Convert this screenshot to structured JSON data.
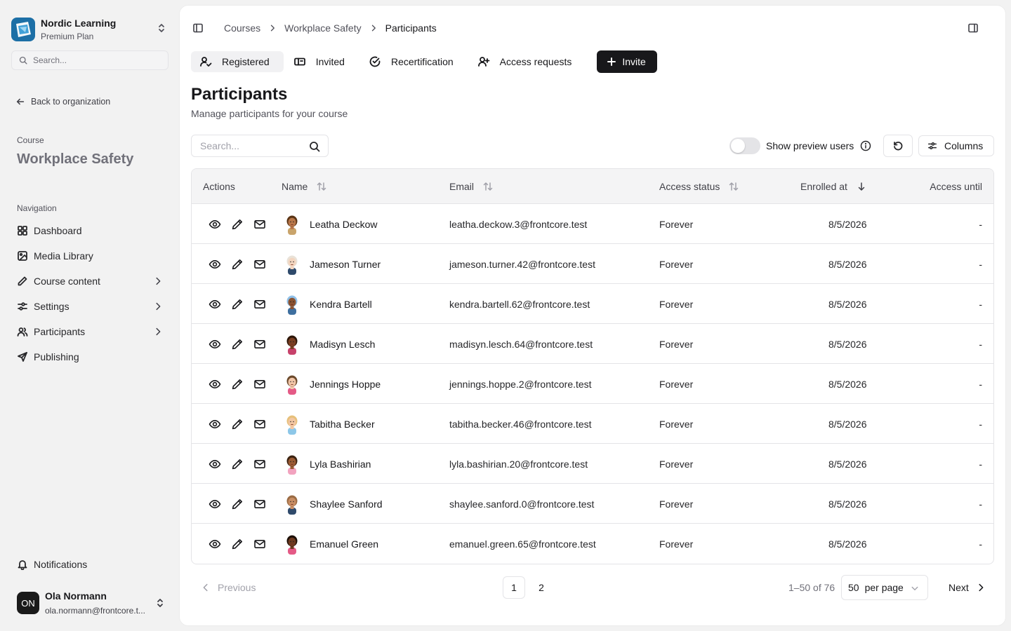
{
  "org": {
    "name": "Nordic Learning",
    "plan": "Premium Plan"
  },
  "sidebar": {
    "search_placeholder": "Search...",
    "back_label": "Back to organization",
    "course_label": "Course",
    "course_name": "Workplace Safety",
    "nav_label": "Navigation",
    "items": [
      {
        "label": "Dashboard",
        "icon": "dashboard-icon",
        "has_chevron": false
      },
      {
        "label": "Media Library",
        "icon": "image-icon",
        "has_chevron": false
      },
      {
        "label": "Course content",
        "icon": "pencil-icon",
        "has_chevron": true
      },
      {
        "label": "Settings",
        "icon": "settings-sliders-icon",
        "has_chevron": true
      },
      {
        "label": "Participants",
        "icon": "users-icon",
        "has_chevron": true
      },
      {
        "label": "Publishing",
        "icon": "send-icon",
        "has_chevron": false
      }
    ],
    "notifications_label": "Notifications",
    "user": {
      "initials": "ON",
      "name": "Ola Normann",
      "email": "ola.normann@frontcore.t..."
    }
  },
  "breadcrumb": [
    "Courses",
    "Workplace Safety",
    "Participants"
  ],
  "tabs": [
    {
      "label": "Registered",
      "icon": "user-check-icon",
      "active": true
    },
    {
      "label": "Invited",
      "icon": "ticket-icon",
      "active": false
    },
    {
      "label": "Recertification",
      "icon": "circle-check-icon",
      "active": false
    },
    {
      "label": "Access requests",
      "icon": "user-plus-icon",
      "active": false
    }
  ],
  "invite_label": "Invite",
  "page": {
    "title": "Participants",
    "subtitle": "Manage participants for your course"
  },
  "toolbar": {
    "search_placeholder": "Search...",
    "preview_label": "Show preview users",
    "preview_enabled": false,
    "columns_label": "Columns"
  },
  "table": {
    "headers": {
      "actions": "Actions",
      "name": "Name",
      "email": "Email",
      "status": "Access status",
      "enrolled": "Enrolled at",
      "until": "Access until"
    },
    "rows": [
      {
        "name": "Leatha Deckow",
        "email": "leatha.deckow.3@frontcore.test",
        "status": "Forever",
        "enrolled": "8/5/2026",
        "until": "-",
        "skin": "#b9774a",
        "hair": "#5a3415",
        "shirt": "#c9a46b"
      },
      {
        "name": "Jameson Turner",
        "email": "jameson.turner.42@frontcore.test",
        "status": "Forever",
        "enrolled": "8/5/2026",
        "until": "-",
        "skin": "#f3d5bf",
        "hair": "#e9e2d8",
        "shirt": "#2f4a6b"
      },
      {
        "name": "Kendra Bartell",
        "email": "kendra.bartell.62@frontcore.test",
        "status": "Forever",
        "enrolled": "8/5/2026",
        "until": "-",
        "skin": "#8a5230",
        "hair": "#8fc0e8",
        "shirt": "#3e6f9f"
      },
      {
        "name": "Madisyn Lesch",
        "email": "madisyn.lesch.64@frontcore.test",
        "status": "Forever",
        "enrolled": "8/5/2026",
        "until": "-",
        "skin": "#7a3f22",
        "hair": "#2c1608",
        "shirt": "#c7426b"
      },
      {
        "name": "Jennings Hoppe",
        "email": "jennings.hoppe.2@frontcore.test",
        "status": "Forever",
        "enrolled": "8/5/2026",
        "until": "-",
        "skin": "#f2c6a8",
        "hair": "#6b4a2c",
        "shirt": "#e45a86"
      },
      {
        "name": "Tabitha Becker",
        "email": "tabitha.becker.46@frontcore.test",
        "status": "Forever",
        "enrolled": "8/5/2026",
        "until": "-",
        "skin": "#f3c7a3",
        "hair": "#e6c07a",
        "shirt": "#8dc7e8"
      },
      {
        "name": "Lyla Bashirian",
        "email": "lyla.bashirian.20@frontcore.test",
        "status": "Forever",
        "enrolled": "8/5/2026",
        "until": "-",
        "skin": "#9b5b34",
        "hair": "#3b2210",
        "shirt": "#f2a3bf"
      },
      {
        "name": "Shaylee Sanford",
        "email": "shaylee.sanford.0@frontcore.test",
        "status": "Forever",
        "enrolled": "8/5/2026",
        "until": "-",
        "skin": "#c98e64",
        "hair": "#9a6b43",
        "shirt": "#2f4a6b"
      },
      {
        "name": "Emanuel Green",
        "email": "emanuel.green.65@frontcore.test",
        "status": "Forever",
        "enrolled": "8/5/2026",
        "until": "-",
        "skin": "#6e3a20",
        "hair": "#1c0f06",
        "shirt": "#e45a86"
      }
    ]
  },
  "pagination": {
    "prev_label": "Previous",
    "pages": [
      "1",
      "2"
    ],
    "current_page": "1",
    "range": "1–50 of 76",
    "per_page_value": "50",
    "per_page_unit": "per page",
    "next_label": "Next"
  },
  "colors": {
    "primary": "#18181b",
    "border": "#e4e4e7",
    "muted": "#71717a",
    "sidebar_bg": "#f2f2f2"
  }
}
